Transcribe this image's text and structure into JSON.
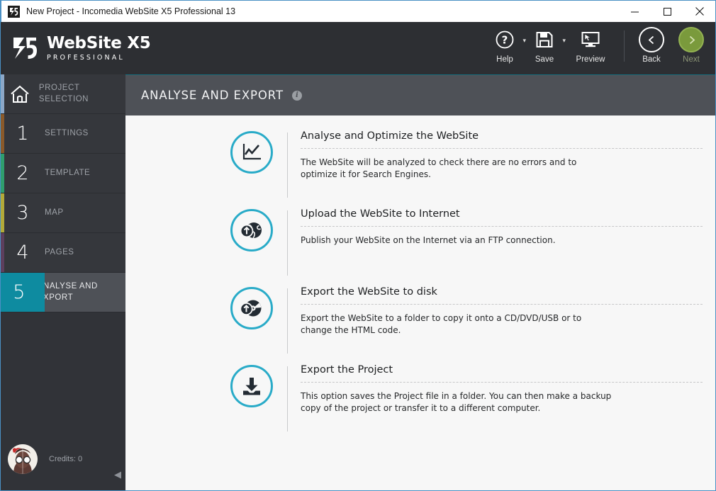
{
  "window": {
    "title": "New Project - Incomedia WebSite X5 Professional 13",
    "app_icon": "x5-logo-icon",
    "controls": {
      "minimize": "—",
      "maximize": "☐",
      "close": "✕"
    }
  },
  "brand": {
    "name": "WebSite X5",
    "edition": "PROFESSIONAL",
    "logo_icon": "x5-brand-icon"
  },
  "toolbar": {
    "items": [
      {
        "label": "Help",
        "icon": "question-mark-icon",
        "has_caret": true
      },
      {
        "label": "Save",
        "icon": "floppy-disk-icon",
        "has_caret": true
      },
      {
        "label": "Preview",
        "icon": "monitor-cursor-icon",
        "has_caret": false
      }
    ],
    "back": {
      "label": "Back",
      "icon": "chevron-left-icon"
    },
    "next": {
      "label": "Next",
      "icon": "chevron-right-icon",
      "disabled": true
    }
  },
  "sidebar": {
    "items": [
      {
        "marker": "",
        "icon": "home-icon",
        "label": "PROJECT SELECTION",
        "stripe": "#8ca8c8",
        "active": false
      },
      {
        "marker": "1",
        "icon": "",
        "label": "SETTINGS",
        "stripe": "#8a5a2b",
        "active": false
      },
      {
        "marker": "2",
        "icon": "",
        "label": "TEMPLATE",
        "stripe": "#2f9e6e",
        "active": false
      },
      {
        "marker": "3",
        "icon": "",
        "label": "MAP",
        "stripe": "#b2aa3a",
        "active": false
      },
      {
        "marker": "4",
        "icon": "",
        "label": "PAGES",
        "stripe": "#5d3f5e",
        "active": false
      },
      {
        "marker": "5",
        "icon": "",
        "label": "ANALYSE AND EXPORT",
        "stripe": "#0e8ba0",
        "active": true
      }
    ],
    "credits_label": "Credits: 0",
    "avatar_icon": "user-avatar-icon",
    "collapse_icon": "collapse-left-icon"
  },
  "main": {
    "title": "ANALYSE AND EXPORT",
    "info_icon": "info-icon",
    "options": [
      {
        "icon": "line-chart-icon",
        "title": "Analyse and Optimize the WebSite",
        "description": "The WebSite will be analyzed to check there are no errors and to optimize it for Search Engines."
      },
      {
        "icon": "globe-upload-icon",
        "title": "Upload the WebSite to Internet",
        "description": "Publish your WebSite on the Internet via an FTP connection."
      },
      {
        "icon": "disc-export-icon",
        "title": "Export the WebSite to disk",
        "description": "Export the WebSite to a folder to copy it onto a CD/DVD/USB or to change the HTML code."
      },
      {
        "icon": "download-tray-icon",
        "title": "Export the Project",
        "description": "This option saves the Project file in a folder.  You can then make a backup copy of the project or transfer it to a different computer."
      }
    ]
  },
  "colors": {
    "accent_teal": "#0e8ba0",
    "icon_teal": "#29abc8",
    "next_green": "#7a9a3c",
    "chrome_dark": "#2d2f33",
    "panel_gray": "#4e5157",
    "window_border": "#4a90c4"
  }
}
